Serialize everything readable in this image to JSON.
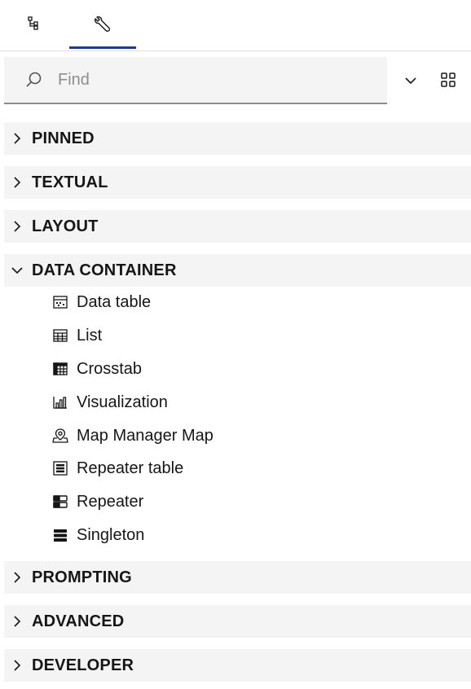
{
  "tabs": [
    {
      "name": "data-tree",
      "icon": "data-tree-icon",
      "active": false
    },
    {
      "name": "toolbox",
      "icon": "wrench-icon",
      "active": true
    }
  ],
  "search": {
    "placeholder": "Find",
    "value": ""
  },
  "sections": {
    "pinned": {
      "label": "PINNED",
      "expanded": false
    },
    "textual": {
      "label": "TEXTUAL",
      "expanded": false
    },
    "layout": {
      "label": "LAYOUT",
      "expanded": false
    },
    "data_container": {
      "label": "DATA CONTAINER",
      "expanded": true,
      "items": [
        {
          "label": "Data table",
          "icon": "data-table-icon"
        },
        {
          "label": "List",
          "icon": "list-icon"
        },
        {
          "label": "Crosstab",
          "icon": "crosstab-icon"
        },
        {
          "label": "Visualization",
          "icon": "visualization-icon"
        },
        {
          "label": "Map Manager Map",
          "icon": "map-pin-icon"
        },
        {
          "label": "Repeater table",
          "icon": "repeater-table-icon"
        },
        {
          "label": "Repeater",
          "icon": "repeater-icon"
        },
        {
          "label": "Singleton",
          "icon": "singleton-icon"
        }
      ]
    },
    "prompting": {
      "label": "PROMPTING",
      "expanded": false
    },
    "advanced": {
      "label": "ADVANCED",
      "expanded": false
    },
    "developer": {
      "label": "DEVELOPER",
      "expanded": false
    }
  },
  "colors": {
    "accent": "#1d3d8a",
    "section_bg": "#f4f4f4",
    "text": "#161616",
    "placeholder": "#8d8d8d"
  }
}
